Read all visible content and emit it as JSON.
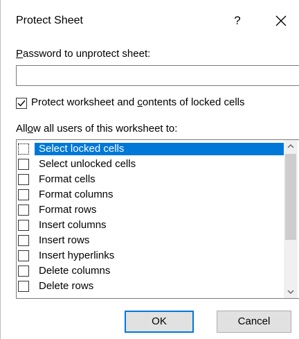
{
  "dialog": {
    "title": "Protect Sheet",
    "help_label": "?",
    "close_icon": "close-icon"
  },
  "password": {
    "label_first": "P",
    "label_rest": "assword to unprotect sheet:",
    "value": "",
    "placeholder": ""
  },
  "protect": {
    "checked": true,
    "label_before": "Protect worksheet and ",
    "label_underlined": "c",
    "label_after": "ontents of locked cells"
  },
  "permissions": {
    "label_before": "All",
    "label_underlined": "o",
    "label_after": "w all users of this worksheet to:",
    "items": [
      {
        "label": "Select locked cells",
        "checked": false,
        "selected": true
      },
      {
        "label": "Select unlocked cells",
        "checked": false,
        "selected": false
      },
      {
        "label": "Format cells",
        "checked": false,
        "selected": false
      },
      {
        "label": "Format columns",
        "checked": false,
        "selected": false
      },
      {
        "label": "Format rows",
        "checked": false,
        "selected": false
      },
      {
        "label": "Insert columns",
        "checked": false,
        "selected": false
      },
      {
        "label": "Insert rows",
        "checked": false,
        "selected": false
      },
      {
        "label": "Insert hyperlinks",
        "checked": false,
        "selected": false
      },
      {
        "label": "Delete columns",
        "checked": false,
        "selected": false
      },
      {
        "label": "Delete rows",
        "checked": false,
        "selected": false
      }
    ]
  },
  "buttons": {
    "ok": "OK",
    "cancel": "Cancel"
  },
  "colors": {
    "selection": "#0078d7",
    "button_face": "#e1e1e1",
    "default_button_border": "#0078d7"
  }
}
